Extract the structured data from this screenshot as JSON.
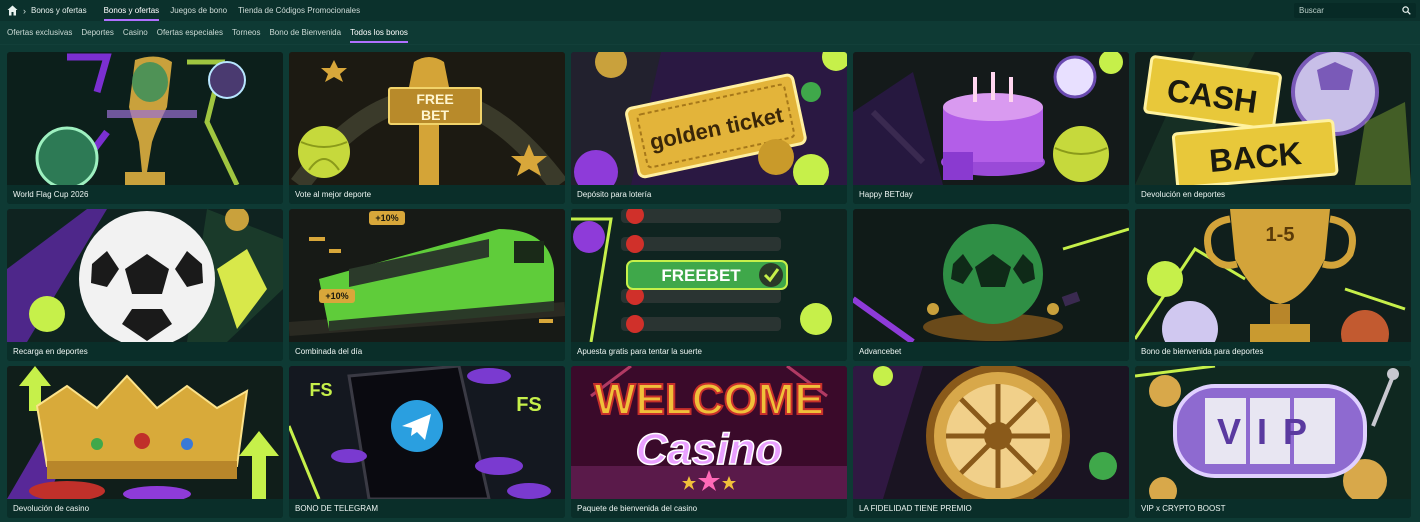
{
  "breadcrumb": {
    "home_icon": "home-icon",
    "separator": "›",
    "current": "Bonos y ofertas"
  },
  "top_tabs": [
    {
      "label": "Bonos y ofertas",
      "active": true
    },
    {
      "label": "Juegos de bono",
      "active": false
    },
    {
      "label": "Tienda de Códigos Promocionales",
      "active": false
    }
  ],
  "search": {
    "placeholder": "Buscar",
    "icon": "search-icon"
  },
  "sub_tabs": [
    {
      "label": "Ofertas exclusivas",
      "active": false
    },
    {
      "label": "Deportes",
      "active": false
    },
    {
      "label": "Casino",
      "active": false
    },
    {
      "label": "Ofertas especiales",
      "active": false
    },
    {
      "label": "Torneos",
      "active": false
    },
    {
      "label": "Bono de Bienvenida",
      "active": false
    },
    {
      "label": "Todos los bonos",
      "active": true
    }
  ],
  "colors": {
    "background": "#0e3a34",
    "topbar": "#0b312c",
    "accent_underline": "#b070ff",
    "neon_green": "#c6f04a",
    "purple": "#8e3bd9"
  },
  "cards": [
    {
      "title": "World Flag Cup 2026",
      "art": "trophy-art",
      "art_text": ""
    },
    {
      "title": "Vote al mejor deporte",
      "art": "freebet-statue-art",
      "art_text": "FREE BET"
    },
    {
      "title": "Depósito para lotería",
      "art": "golden-ticket-art",
      "art_text": "golden ticket"
    },
    {
      "title": "Happy BETday",
      "art": "birthday-cake-art",
      "art_text": ""
    },
    {
      "title": "Devolución en deportes",
      "art": "cashback-art",
      "art_text": "CASH BACK"
    },
    {
      "title": "Recarga en deportes",
      "art": "soccer-ball-art",
      "art_text": ""
    },
    {
      "title": "Combinada del día",
      "art": "train-art",
      "art_text": "+10%"
    },
    {
      "title": "Apuesta gratis para tentar la suerte",
      "art": "freebet-list-art",
      "art_text": "FREEBET"
    },
    {
      "title": "Advancebet",
      "art": "green-ball-art",
      "art_text": ""
    },
    {
      "title": "Bono de bienvenida para deportes",
      "art": "cup-trophy-art",
      "art_text": "1-5"
    },
    {
      "title": "Devolución de casino",
      "art": "crown-art",
      "art_text": ""
    },
    {
      "title": "BONO DE TELEGRAM",
      "art": "telegram-art",
      "art_text": "FS"
    },
    {
      "title": "Paquete de bienvenida del casino",
      "art": "welcome-casino-art",
      "art_text": "WELCOME Casino"
    },
    {
      "title": "LA FIDELIDAD TIENE PREMIO",
      "art": "wheel-art",
      "art_text": ""
    },
    {
      "title": "VIP x CRYPTO BOOST",
      "art": "vip-slot-art",
      "art_text": "VIP"
    }
  ]
}
